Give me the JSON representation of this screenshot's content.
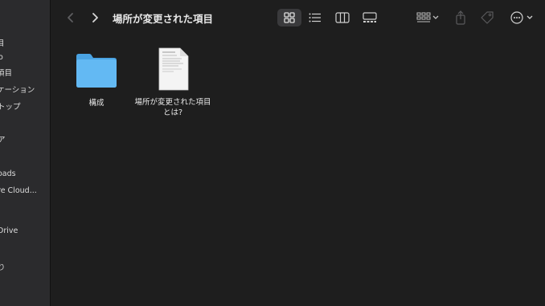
{
  "window": {
    "title": "場所が変更された項目"
  },
  "sidebar": {
    "items": [
      {
        "label": "目"
      },
      {
        "label": "o"
      },
      {
        "label": "項目"
      },
      {
        "label": "ケーション"
      },
      {
        "label": "トップ"
      },
      {
        "label": "ア"
      },
      {
        "label": "oads"
      },
      {
        "label": "re Cloud..."
      },
      {
        "label": "Drive"
      },
      {
        "label": "り"
      }
    ]
  },
  "files": [
    {
      "name": "構成",
      "kind": "folder"
    },
    {
      "name": "場所が変更された項目とは?",
      "kind": "document"
    }
  ],
  "toolbar": {
    "back": "chevron-left-icon",
    "forward": "chevron-right-icon",
    "views": [
      "icon-view",
      "list-view",
      "column-view",
      "gallery-view"
    ],
    "selected_view": "icon-view",
    "actions": [
      "group-icon",
      "share-icon",
      "tag-icon",
      "more-icon"
    ]
  },
  "colors": {
    "background": "#1e1e1e",
    "sidebar": "#2b2b2d",
    "folder": "#5ab2f0"
  }
}
